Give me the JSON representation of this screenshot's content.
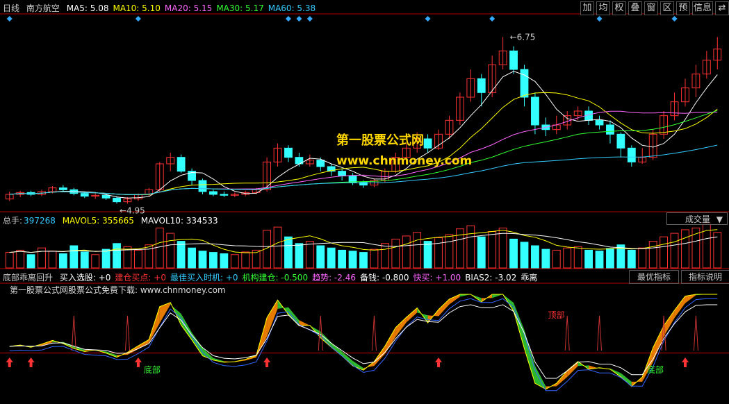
{
  "top": {
    "period": "日线",
    "stock_name": "南方航空",
    "ma_labels": [
      {
        "label": "MA5: 5.08",
        "color": "#ffffff"
      },
      {
        "label": "MA10: 5.10",
        "color": "#ffff00"
      },
      {
        "label": "MA20: 5.15",
        "color": "#ff66ff"
      },
      {
        "label": "MA30: 5.17",
        "color": "#33ff33"
      },
      {
        "label": "MA60: 5.38",
        "color": "#33ccff"
      }
    ],
    "toolbar": [
      "加",
      "均",
      "权",
      "叠",
      "窗",
      "区",
      "预",
      "信息",
      "⇄"
    ]
  },
  "volume": {
    "label_total": "总手:",
    "total": "397268",
    "mavol5": "MAVOL5: 355665",
    "mavol10": "MAVOL10: 334533",
    "selector": "成交量"
  },
  "indicator": {
    "name": "底部乖离回升",
    "items": [
      {
        "label": "买入选股: +0",
        "color": "#ffffff"
      },
      {
        "label": "建仓买点: +0",
        "color": "#ff3333"
      },
      {
        "label": "最佳买入时机: +0",
        "color": "#33ccff"
      },
      {
        "label": "机构建仓: -0.500",
        "color": "#33ff33"
      },
      {
        "label": "趋势: -2.46",
        "color": "#ff66ff"
      },
      {
        "label": "备钱: -0.800",
        "color": "#ffffff"
      },
      {
        "label": "快买: +1.00",
        "color": "#ff66ff"
      },
      {
        "label": "BIAS2: -3.02",
        "color": "#ffffff"
      },
      {
        "label": "乖离",
        "color": "#ffffff"
      }
    ],
    "btn_best": "最优指标",
    "btn_help": "指标说明",
    "subnote": "第一股票公式网股票公式免费下载: www.chnmoney.com",
    "marks": [
      "底部",
      "顶部",
      "底部",
      "顶部"
    ]
  },
  "watermark": {
    "line1": "第一股票公式网",
    "line2": "www.chnmoney.com"
  },
  "annotations": {
    "high": "6.75",
    "low": "4.95"
  },
  "colors": {
    "up": "#ff3333",
    "down": "#33ffff",
    "ma5": "#ffffff",
    "ma10": "#ffff00",
    "ma20": "#ff66ff",
    "ma30": "#33ff33",
    "ma60": "#33ccff",
    "frame": "#b00000"
  },
  "chart_data": {
    "type": "candlestick",
    "price_range": [
      4.9,
      6.85
    ],
    "candles": [
      [
        5.0,
        5.05,
        4.98,
        5.08
      ],
      [
        5.05,
        5.07,
        5.02,
        5.09
      ],
      [
        5.07,
        5.05,
        5.03,
        5.09
      ],
      [
        5.05,
        5.08,
        5.03,
        5.1
      ],
      [
        5.08,
        5.12,
        5.06,
        5.14
      ],
      [
        5.12,
        5.1,
        5.08,
        5.15
      ],
      [
        5.1,
        5.06,
        5.04,
        5.12
      ],
      [
        5.06,
        5.03,
        5.01,
        5.08
      ],
      [
        5.03,
        5.04,
        5.0,
        5.06
      ],
      [
        5.04,
        5.01,
        4.99,
        5.06
      ],
      [
        5.01,
        4.97,
        4.95,
        5.03
      ],
      [
        4.97,
        5.0,
        4.95,
        5.02
      ],
      [
        5.0,
        5.05,
        4.98,
        5.06
      ],
      [
        5.05,
        5.1,
        5.03,
        5.12
      ],
      [
        5.1,
        5.38,
        5.08,
        5.4
      ],
      [
        5.38,
        5.45,
        5.3,
        5.5
      ],
      [
        5.45,
        5.3,
        5.28,
        5.48
      ],
      [
        5.3,
        5.2,
        5.15,
        5.33
      ],
      [
        5.2,
        5.08,
        5.05,
        5.22
      ],
      [
        5.08,
        5.05,
        5.03,
        5.1
      ],
      [
        5.05,
        5.04,
        5.02,
        5.08
      ],
      [
        5.04,
        5.05,
        5.02,
        5.07
      ],
      [
        5.05,
        5.07,
        5.03,
        5.09
      ],
      [
        5.07,
        5.1,
        5.05,
        5.12
      ],
      [
        5.1,
        5.4,
        5.08,
        5.45
      ],
      [
        5.4,
        5.55,
        5.35,
        5.6
      ],
      [
        5.55,
        5.45,
        5.4,
        5.58
      ],
      [
        5.45,
        5.38,
        5.35,
        5.5
      ],
      [
        5.38,
        5.42,
        5.35,
        5.48
      ],
      [
        5.42,
        5.35,
        5.3,
        5.45
      ],
      [
        5.35,
        5.3,
        5.25,
        5.38
      ],
      [
        5.3,
        5.25,
        5.2,
        5.33
      ],
      [
        5.25,
        5.18,
        5.15,
        5.28
      ],
      [
        5.18,
        5.15,
        5.12,
        5.2
      ],
      [
        5.15,
        5.2,
        5.13,
        5.22
      ],
      [
        5.2,
        5.3,
        5.18,
        5.33
      ],
      [
        5.3,
        5.45,
        5.28,
        5.5
      ],
      [
        5.45,
        5.55,
        5.4,
        5.6
      ],
      [
        5.55,
        5.65,
        5.5,
        5.72
      ],
      [
        5.65,
        5.55,
        5.5,
        5.7
      ],
      [
        5.55,
        5.7,
        5.53,
        5.75
      ],
      [
        5.7,
        5.85,
        5.65,
        5.9
      ],
      [
        5.85,
        6.1,
        5.8,
        6.15
      ],
      [
        6.1,
        6.3,
        6.05,
        6.4
      ],
      [
        6.3,
        6.15,
        6.0,
        6.35
      ],
      [
        6.15,
        6.45,
        6.1,
        6.55
      ],
      [
        6.45,
        6.6,
        6.4,
        6.75
      ],
      [
        6.6,
        6.4,
        6.35,
        6.65
      ],
      [
        6.4,
        6.1,
        6.0,
        6.45
      ],
      [
        6.1,
        5.8,
        5.7,
        6.15
      ],
      [
        5.8,
        5.75,
        5.68,
        5.88
      ],
      [
        5.75,
        5.8,
        5.7,
        5.9
      ],
      [
        5.8,
        5.9,
        5.75,
        5.95
      ],
      [
        5.9,
        5.95,
        5.85,
        6.0
      ],
      [
        5.95,
        5.85,
        5.8,
        6.0
      ],
      [
        5.85,
        5.8,
        5.75,
        5.9
      ],
      [
        5.8,
        5.7,
        5.6,
        5.85
      ],
      [
        5.7,
        5.55,
        5.45,
        5.72
      ],
      [
        5.55,
        5.4,
        5.35,
        5.58
      ],
      [
        5.4,
        5.45,
        5.38,
        5.55
      ],
      [
        5.45,
        5.7,
        5.42,
        5.75
      ],
      [
        5.7,
        5.9,
        5.65,
        5.95
      ],
      [
        5.9,
        6.05,
        5.85,
        6.15
      ],
      [
        6.05,
        6.2,
        6.0,
        6.3
      ],
      [
        6.2,
        6.35,
        6.1,
        6.45
      ],
      [
        6.35,
        6.5,
        6.3,
        6.6
      ],
      [
        6.5,
        6.62,
        6.4,
        6.75
      ]
    ],
    "volume_range": [
      0,
      1.0
    ],
    "volumes": [
      0.35,
      0.4,
      0.3,
      0.45,
      0.38,
      0.32,
      0.5,
      0.36,
      0.3,
      0.42,
      0.55,
      0.48,
      0.4,
      0.52,
      0.9,
      0.78,
      0.6,
      0.45,
      0.38,
      0.35,
      0.32,
      0.3,
      0.36,
      0.4,
      0.85,
      0.92,
      0.7,
      0.55,
      0.6,
      0.5,
      0.45,
      0.4,
      0.38,
      0.35,
      0.42,
      0.55,
      0.65,
      0.72,
      0.8,
      0.6,
      0.68,
      0.75,
      0.88,
      0.95,
      0.7,
      0.82,
      0.9,
      0.65,
      0.58,
      0.5,
      0.42,
      0.4,
      0.45,
      0.48,
      0.4,
      0.38,
      0.44,
      0.52,
      0.4,
      0.45,
      0.6,
      0.7,
      0.78,
      0.86,
      0.9,
      0.98,
      0.8
    ],
    "indicator_range": [
      -1,
      1
    ]
  }
}
